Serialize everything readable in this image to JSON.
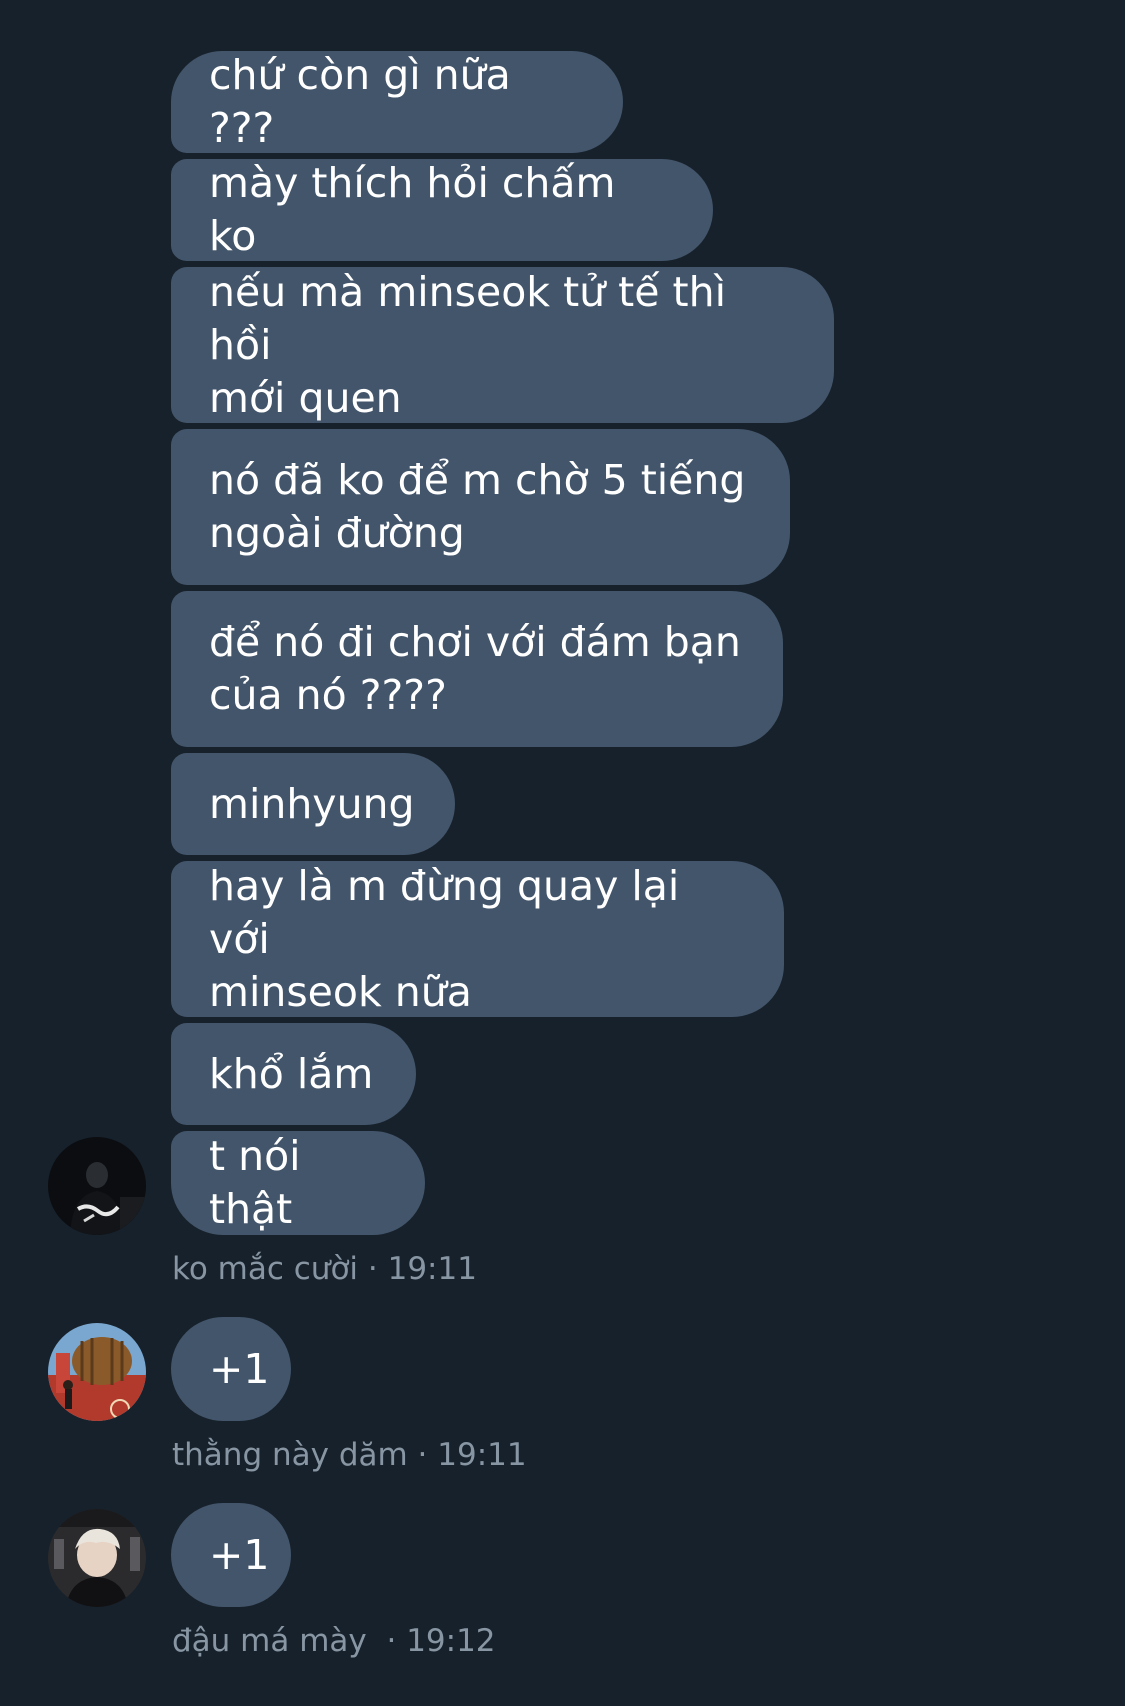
{
  "colors": {
    "background": "#17212b",
    "bubble": "#43556a",
    "bubble_text": "#ffffff",
    "meta_text": "#8896a4"
  },
  "groups": [
    {
      "sender": "ko mắc cười",
      "time": "19:11",
      "avatar": "avatar-dark-person-icon",
      "messages": [
        "chứ còn gì nữa ???",
        "mày thích hỏi chấm ko",
        "nếu mà minseok tử tế thì hồi\nmới quen",
        "nó đã ko để m chờ 5 tiếng\nngoài đường",
        "để nó đi chơi với đám bạn\ncủa nó ????",
        "minhyung",
        "hay là m đừng quay lại với\nminseok nữa",
        "khổ lắm",
        "t nói thật"
      ]
    },
    {
      "sender": "thằng này dăm",
      "time": "19:11",
      "avatar": "avatar-barrel-photo-icon",
      "messages": [
        "+1"
      ]
    },
    {
      "sender": "đậu má mày ",
      "time": "19:12",
      "avatar": "avatar-boy-photo-icon",
      "messages": [
        "+1"
      ]
    }
  ]
}
